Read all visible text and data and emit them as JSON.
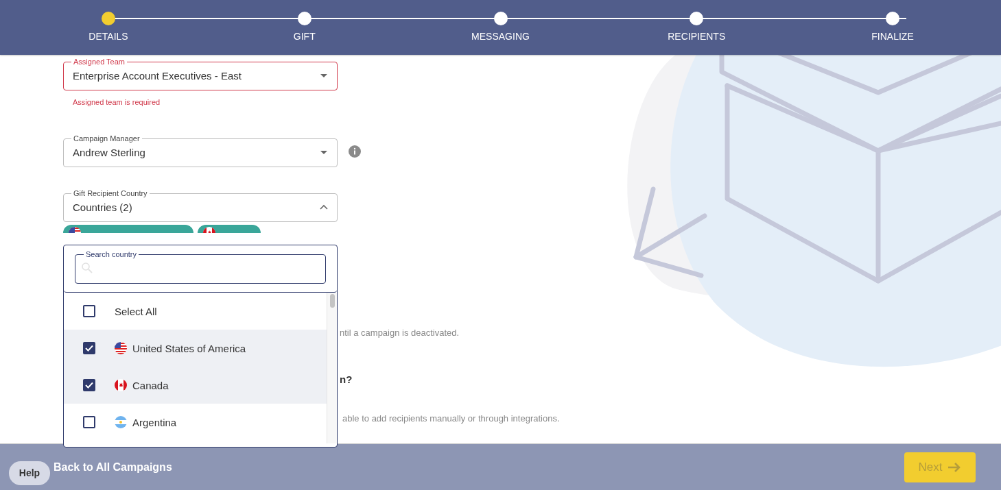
{
  "stepper": {
    "steps": [
      {
        "label": "DETAILS",
        "selected": true
      },
      {
        "label": "GIFT",
        "selected": false
      },
      {
        "label": "MESSAGING",
        "selected": false
      },
      {
        "label": "RECIPIENTS",
        "selected": false
      },
      {
        "label": "FINALIZE",
        "selected": false
      }
    ]
  },
  "fields": [
    {
      "label": "Assigned Team",
      "value": "Enterprise Account Executives - East",
      "error": true,
      "error_text": "Assigned team is required",
      "expanded": false,
      "info_icon": false
    },
    {
      "label": "Campaign Manager",
      "value": "Andrew Sterling",
      "error": false,
      "expanded": false,
      "info_icon": true
    },
    {
      "label": "Gift Recipient Country",
      "value": "Countries (2)",
      "error": false,
      "expanded": true,
      "info_icon": false
    }
  ],
  "chips": [
    {
      "kind": "us_flag"
    },
    {
      "kind": "ca_flag"
    }
  ],
  "dropdown": {
    "search_label": "Search country",
    "items": [
      {
        "kind": "select_all",
        "label": "Select All",
        "checked": false
      },
      {
        "kind": "us_flag",
        "label": "United States of America",
        "checked": true
      },
      {
        "kind": "ca_flag",
        "label": "Canada",
        "checked": true
      },
      {
        "kind": "ar_flag",
        "label": "Argentina",
        "checked": false
      }
    ]
  },
  "hidden_texts": [
    {
      "kind": "note",
      "text": "ntil a campaign is deactivated."
    },
    {
      "kind": "heading",
      "text": "n?"
    },
    {
      "kind": "note",
      "text": "able to add recipients manually or through integrations."
    }
  ],
  "footer": {
    "help": "Help",
    "back": "Back to All Campaigns",
    "next": {
      "label": "Next",
      "disabled": true
    }
  }
}
